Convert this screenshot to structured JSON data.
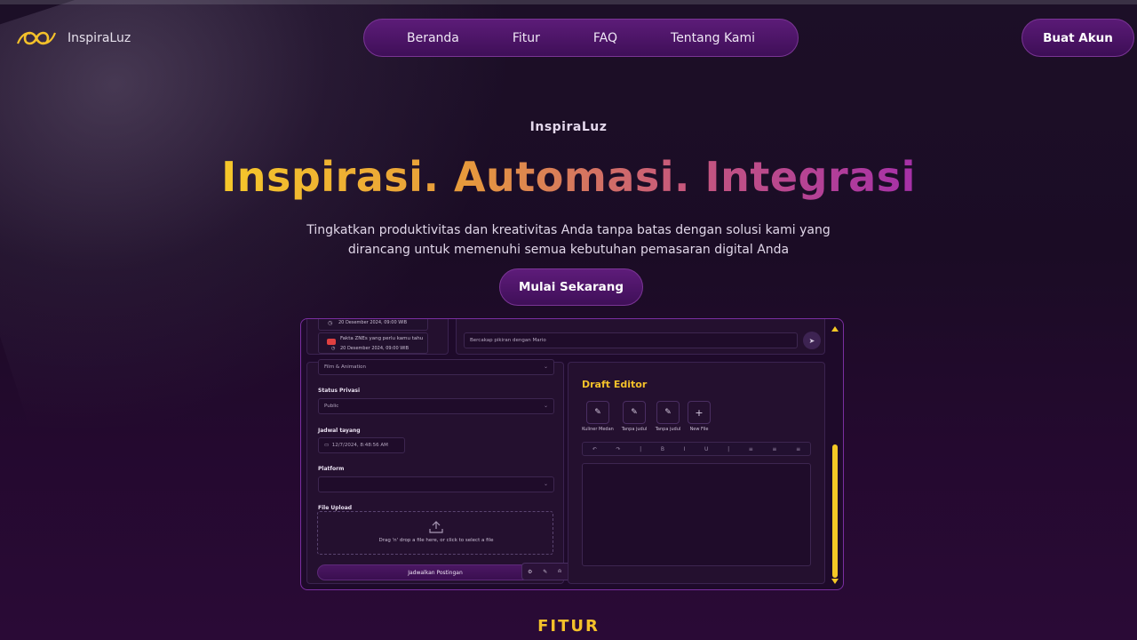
{
  "brand": {
    "name": "InspiraLuz"
  },
  "nav": {
    "items": [
      "Beranda",
      "Fitur",
      "FAQ",
      "Tentang Kami"
    ]
  },
  "header": {
    "create_account": "Buat Akun"
  },
  "hero": {
    "eyebrow": "InspiraLuz",
    "headline": "Inspirasi. Automasi. Integrasi",
    "subtitle_line1": "Tingkatkan produktivitas dan kreativitas Anda tanpa batas dengan solusi kami yang",
    "subtitle_line2": "dirancang untuk memenuhi semua kebutuhan pemasaran digital Anda",
    "cta": "Mulai Sekarang"
  },
  "preview": {
    "notifications": [
      {
        "title": "",
        "time": "20 Desember 2024, 09:00 WIB"
      },
      {
        "title": "Fakta ZNEs yang perlu kamu tahu",
        "time": "20 Desember 2024, 09:00 WIB"
      }
    ],
    "chat_placeholder": "Bercakap pikiran dengan Mario",
    "category_value": "Film & Animation",
    "privacy_label": "Status Privasi",
    "privacy_value": "Public",
    "schedule_label": "Jadwal tayang",
    "schedule_value": "12/7/2024, 8:48:56 AM",
    "platform_label": "Platform",
    "upload_label": "File Upload",
    "upload_hint": "Drag 'n' drop a file here, or click to select a file",
    "schedule_button": "Jadwalkan Postingan",
    "draft_title": "Draft Editor",
    "drafts": [
      "Kuliner Medan",
      "Tanpa judul",
      "Tanpa judul",
      "New File"
    ],
    "colors": {
      "accent": "#f4c12a",
      "purple": "#5c1c78"
    }
  },
  "section": {
    "features_title": "FITUR"
  }
}
